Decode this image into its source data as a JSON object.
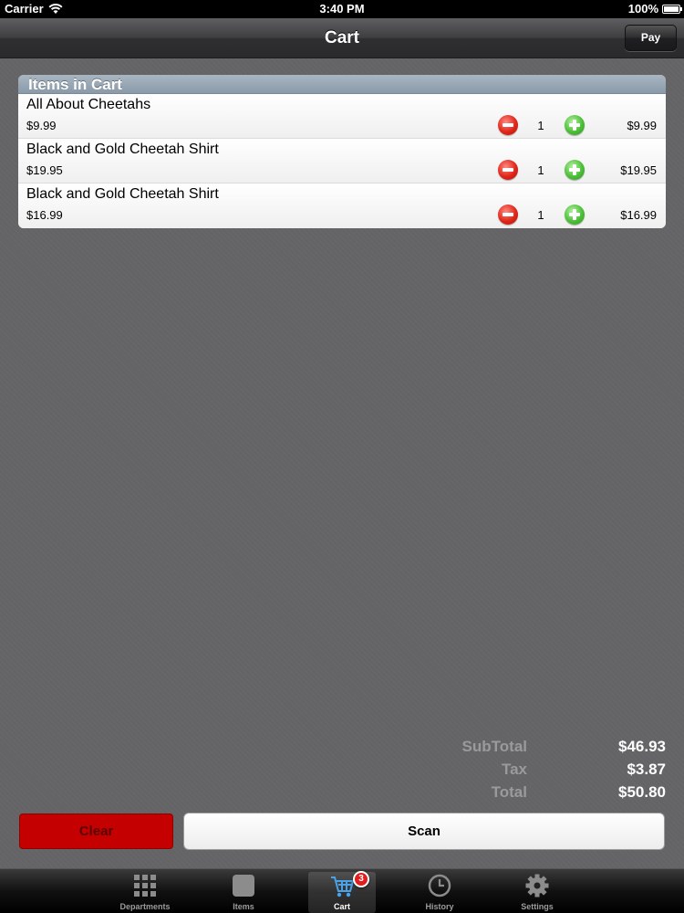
{
  "status_bar": {
    "carrier": "Carrier",
    "time": "3:40 PM",
    "battery": "100%"
  },
  "nav": {
    "title": "Cart",
    "pay_label": "Pay"
  },
  "cart": {
    "header": "Items in Cart",
    "items": [
      {
        "name": "All About Cheetahs",
        "price": "$9.99",
        "qty": "1",
        "total": "$9.99"
      },
      {
        "name": "Black and Gold Cheetah Shirt",
        "price": "$19.95",
        "qty": "1",
        "total": "$19.95"
      },
      {
        "name": "Black and Gold Cheetah Shirt",
        "price": "$16.99",
        "qty": "1",
        "total": "$16.99"
      }
    ]
  },
  "totals": {
    "subtotal_label": "SubTotal",
    "subtotal_value": "$46.93",
    "tax_label": "Tax",
    "tax_value": "$3.87",
    "total_label": "Total",
    "total_value": "$50.80"
  },
  "actions": {
    "clear_label": "Clear",
    "scan_label": "Scan"
  },
  "tabs": [
    {
      "label": "Departments",
      "icon": "grid-icon"
    },
    {
      "label": "Items",
      "icon": "square-icon"
    },
    {
      "label": "Cart",
      "icon": "cart-icon",
      "badge": "3",
      "selected": true
    },
    {
      "label": "History",
      "icon": "clock-icon"
    },
    {
      "label": "Settings",
      "icon": "gear-icon"
    }
  ],
  "colors": {
    "clear_button": "#c40000",
    "badge": "#e21d1d",
    "minus": "#e0261a",
    "plus": "#4cbf38",
    "table_header": "#98a7b5"
  }
}
